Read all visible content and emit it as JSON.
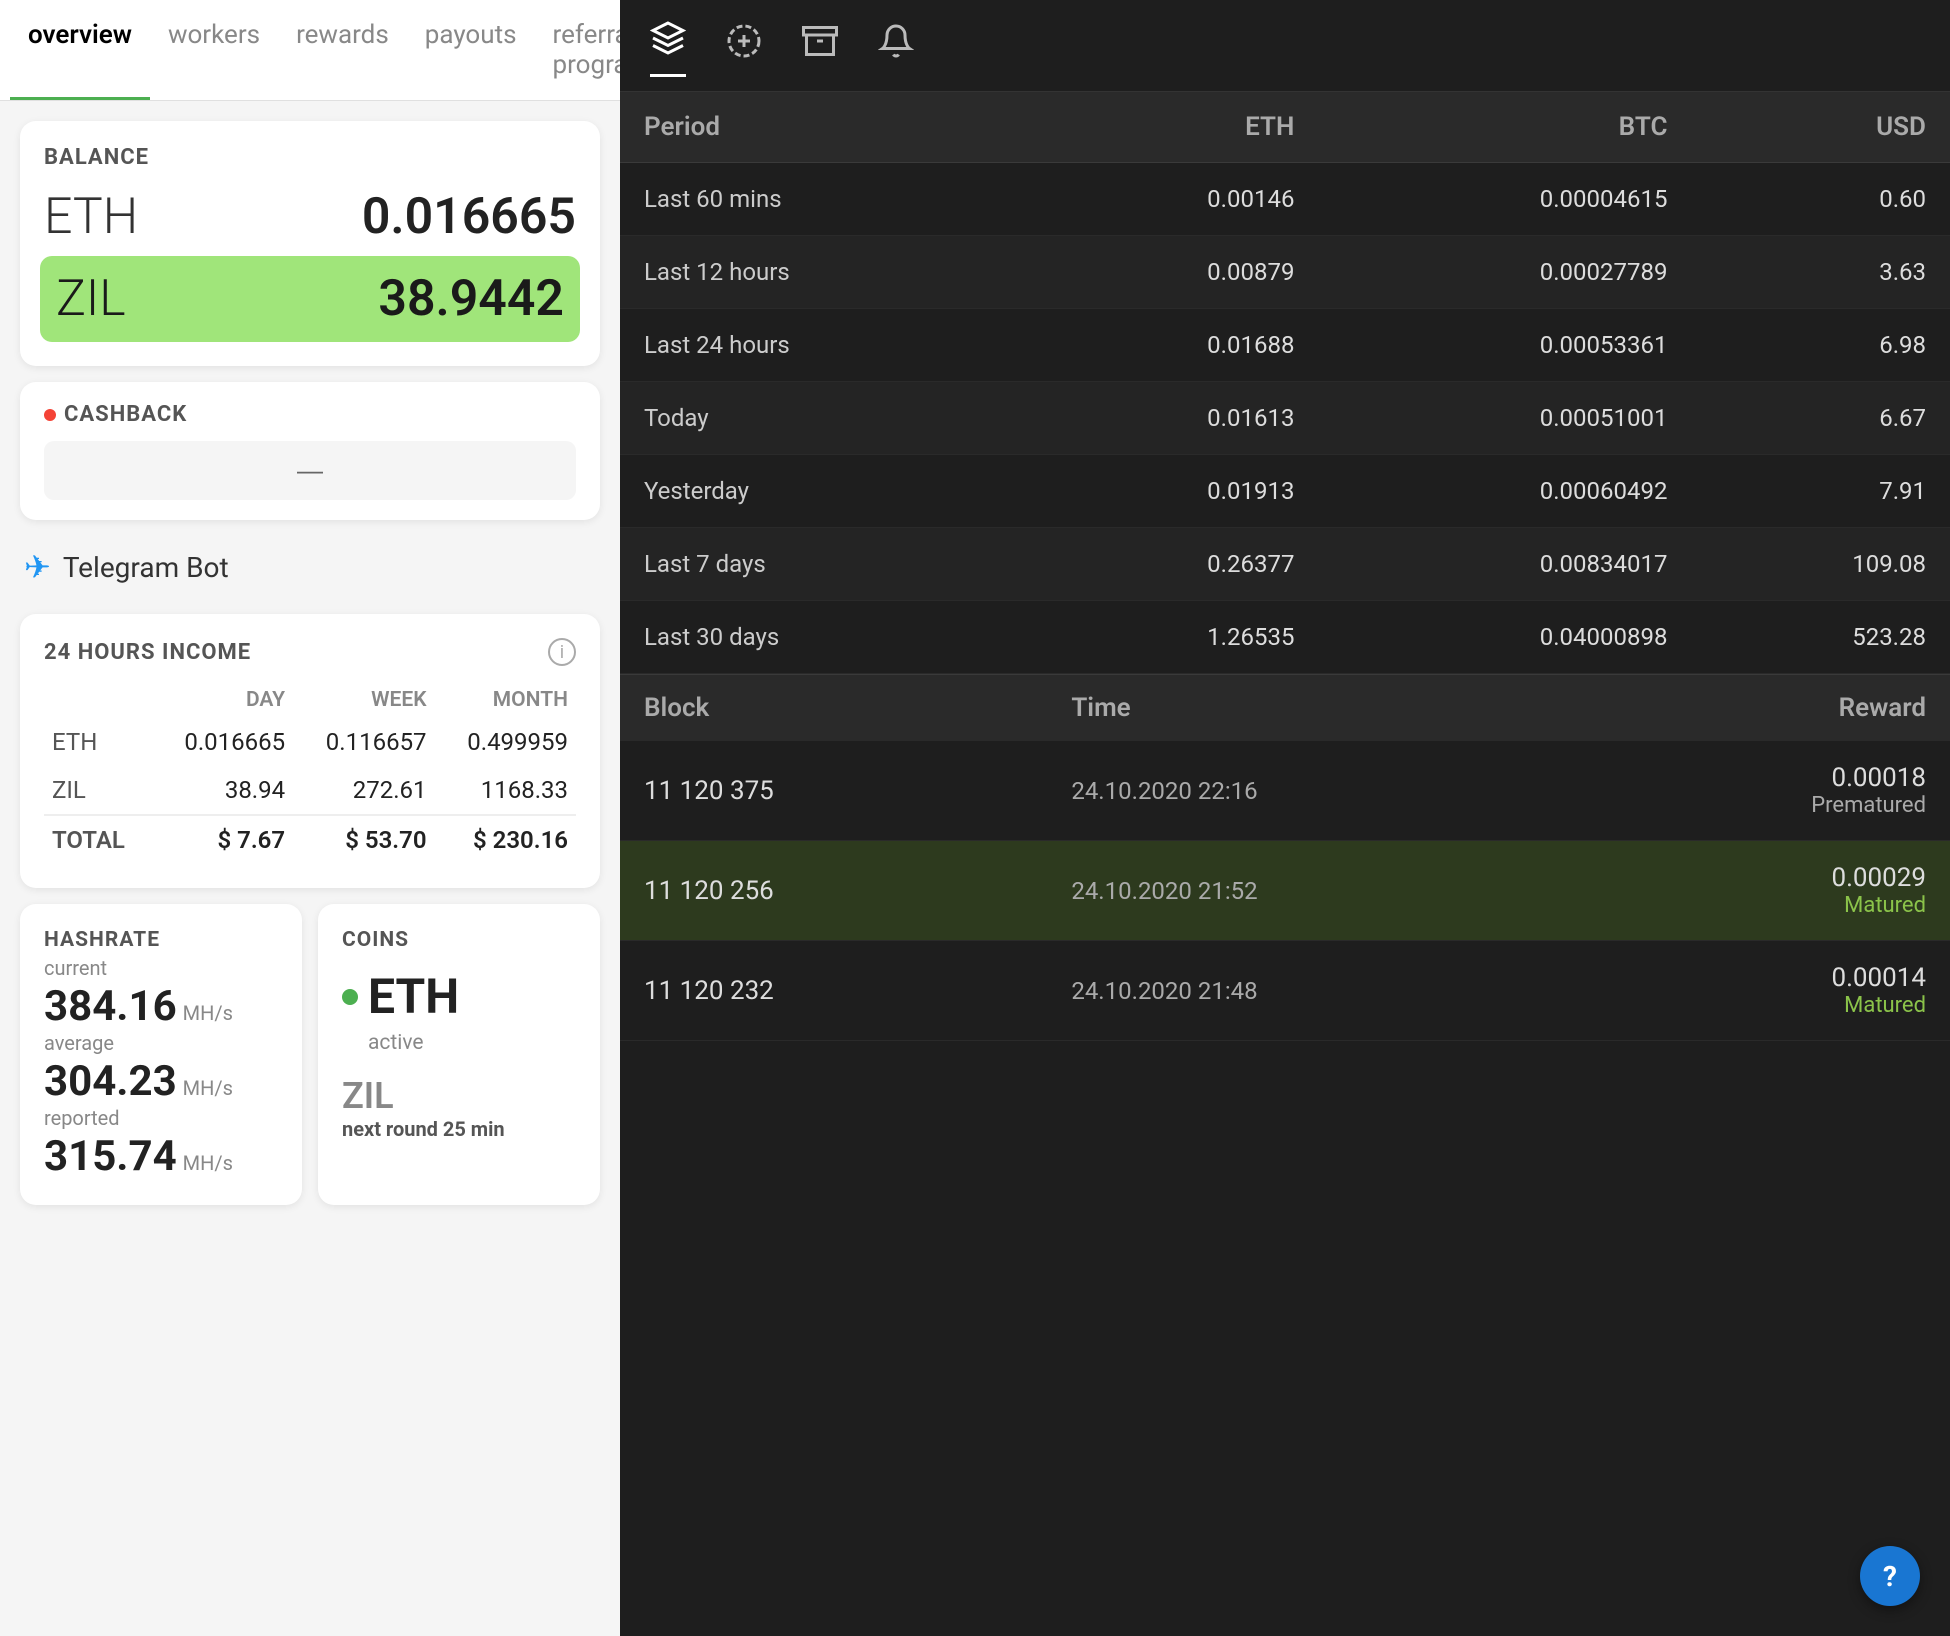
{
  "nav": {
    "tabs": [
      {
        "id": "overview",
        "label": "overview",
        "active": true
      },
      {
        "id": "workers",
        "label": "workers",
        "active": false
      },
      {
        "id": "rewards",
        "label": "rewards",
        "active": false
      },
      {
        "id": "payouts",
        "label": "payouts",
        "active": false
      },
      {
        "id": "referral",
        "label": "referral program",
        "active": false
      }
    ]
  },
  "balance": {
    "label": "BALANCE",
    "eth": {
      "currency": "ETH",
      "amount": "0.016665"
    },
    "zil": {
      "currency": "ZIL",
      "amount": "38.9442"
    }
  },
  "cashback": {
    "label": "CASHBACK",
    "placeholder": "—"
  },
  "telegram": {
    "label": "Telegram Bot"
  },
  "income": {
    "title": "24 HOURS INCOME",
    "headers": [
      "",
      "DAY",
      "WEEK",
      "MONTH"
    ],
    "rows": [
      {
        "coin": "ETH",
        "day": "0.016665",
        "week": "0.116657",
        "month": "0.499959"
      },
      {
        "coin": "ZIL",
        "day": "38.94",
        "week": "272.61",
        "month": "1168.33"
      },
      {
        "coin": "TOTAL",
        "day": "$ 7.67",
        "week": "$ 53.70",
        "month": "$ 230.16"
      }
    ]
  },
  "hashrate": {
    "label": "HASHRATE",
    "current_label": "current",
    "current_value": "384.16",
    "current_unit": "MH/s",
    "average_label": "average",
    "average_value": "304.23",
    "average_unit": "MH/s",
    "reported_label": "reported",
    "reported_value": "315.74",
    "reported_unit": "MH/s"
  },
  "coins": {
    "label": "COINS",
    "eth": {
      "name": "ETH",
      "status": "active"
    },
    "zil": {
      "name": "ZIL",
      "next_round_label": "next round",
      "next_round_value": "25 min"
    }
  },
  "right_header_icons": [
    "layers",
    "circle-dashed",
    "archive",
    "bell"
  ],
  "earnings": {
    "headers": [
      "Period",
      "ETH",
      "BTC",
      "USD"
    ],
    "rows": [
      {
        "period": "Last 60 mins",
        "eth": "0.00146",
        "btc": "0.00004615",
        "usd": "0.60"
      },
      {
        "period": "Last 12 hours",
        "eth": "0.00879",
        "btc": "0.00027789",
        "usd": "3.63"
      },
      {
        "period": "Last 24 hours",
        "eth": "0.01688",
        "btc": "0.00053361",
        "usd": "6.98"
      },
      {
        "period": "Today",
        "eth": "0.01613",
        "btc": "0.00051001",
        "usd": "6.67"
      },
      {
        "period": "Yesterday",
        "eth": "0.01913",
        "btc": "0.00060492",
        "usd": "7.91"
      },
      {
        "period": "Last 7 days",
        "eth": "0.26377",
        "btc": "0.00834017",
        "usd": "109.08"
      },
      {
        "period": "Last 30 days",
        "eth": "1.26535",
        "btc": "0.04000898",
        "usd": "523.28"
      }
    ]
  },
  "blocks": {
    "headers": [
      "Block",
      "Time",
      "Reward"
    ],
    "rows": [
      {
        "block": "11 120 375",
        "time": "24.10.2020 22:16",
        "amount": "0.00018",
        "status": "Prematured",
        "status_type": "prematured",
        "highlight": false
      },
      {
        "block": "11 120 256",
        "time": "24.10.2020 21:52",
        "amount": "0.00029",
        "status": "Matured",
        "status_type": "matured",
        "highlight": true
      },
      {
        "block": "11 120 232",
        "time": "24.10.2020 21:48",
        "amount": "0.00014",
        "status": "Matured",
        "status_type": "matured",
        "highlight": false
      }
    ]
  },
  "help_button_label": "?"
}
